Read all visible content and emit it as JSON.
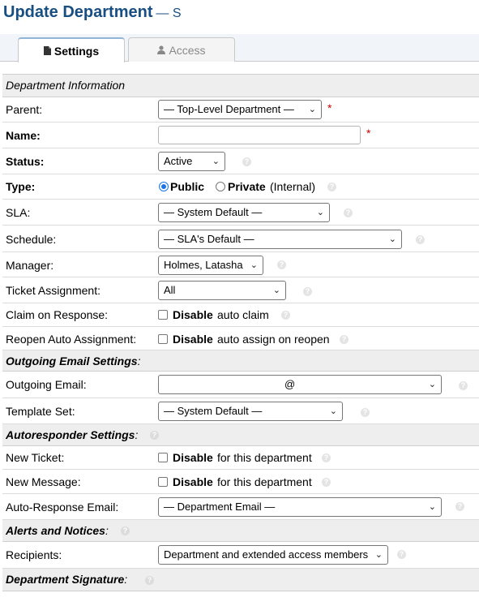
{
  "page": {
    "title": "Update Department",
    "subtitle": "— S"
  },
  "tabs": [
    {
      "label": "Settings",
      "icon": "document-icon",
      "active": true
    },
    {
      "label": "Access",
      "icon": "user-icon",
      "active": false
    }
  ],
  "department_info": {
    "section_title": "Department Information",
    "parent": {
      "label": "Parent:",
      "value": "— Top-Level Department —",
      "required_mark": "*"
    },
    "name": {
      "label": "Name:",
      "value": "",
      "required_mark": "*"
    },
    "status": {
      "label": "Status:",
      "value": "Active"
    },
    "type": {
      "label": "Type:",
      "public_label": "Public",
      "private_label": "Private",
      "private_note": "(Internal)",
      "selected": "Public"
    },
    "sla": {
      "label": "SLA:",
      "value": "— System Default —"
    },
    "schedule": {
      "label": "Schedule:",
      "value": "— SLA's Default —"
    },
    "manager": {
      "label": "Manager:",
      "value": "Holmes, Latasha"
    },
    "ticket_assignment": {
      "label": "Ticket Assignment:",
      "value": "All"
    },
    "claim_on_response": {
      "label": "Claim on Response:",
      "option_bold": "Disable",
      "option_text": "auto claim",
      "checked": false
    },
    "reopen_auto_assignment": {
      "label": "Reopen Auto Assignment:",
      "option_bold": "Disable",
      "option_text": "auto assign on reopen",
      "checked": false
    }
  },
  "outgoing_email": {
    "section_title": "Outgoing Email Settings",
    "section_suffix": ":",
    "email": {
      "label": "Outgoing Email:",
      "value": "@"
    },
    "template_set": {
      "label": "Template Set:",
      "value": "— System Default —"
    }
  },
  "autoresponder": {
    "section_title": "Autoresponder Settings",
    "section_suffix": ":",
    "new_ticket": {
      "label": "New Ticket:",
      "option_bold": "Disable",
      "option_text": "for this department",
      "checked": false
    },
    "new_message": {
      "label": "New Message:",
      "option_bold": "Disable",
      "option_text": "for this department",
      "checked": false
    },
    "auto_response_email": {
      "label": "Auto-Response Email:",
      "value": "— Department Email —"
    }
  },
  "alerts": {
    "section_title": "Alerts and Notices",
    "section_suffix": ":",
    "recipients": {
      "label": "Recipients:",
      "value": "Department and extended access members"
    }
  },
  "signature": {
    "section_title": "Department Signature",
    "section_suffix": ":"
  },
  "help_glyph": "?",
  "chevron_glyph": "⌄"
}
